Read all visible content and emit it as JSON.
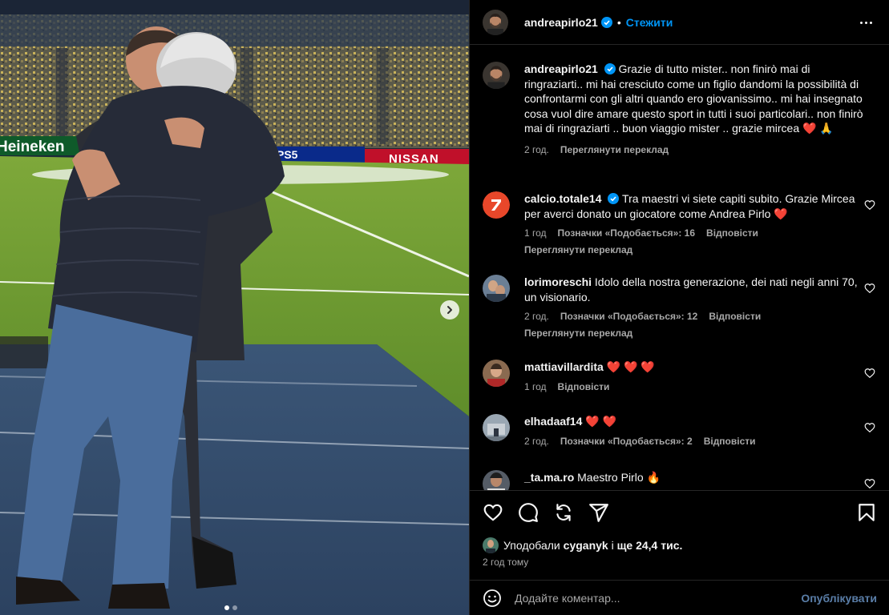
{
  "post": {
    "username": "andreapirlo21",
    "separator": "•",
    "follow_label": "Стежити",
    "caption": "Grazie di tutto mister.. non finirò mai di ringraziarti.. mi hai cresciuto come un figlio dandomi la possibilità di confrontarmi con gli altri quando ero giovanissimo.. mi hai insegnato cosa vuol dire amare questo sport in tutti i suoi particolari.. non finirò mai di ringraziarti .. buon viaggio mister .. grazie mircea ❤️ 🙏",
    "caption_time": "2 год.",
    "caption_translate": "Переглянути переклад"
  },
  "photo": {
    "banners": [
      "Heineken",
      "PS5",
      "NISSAN"
    ]
  },
  "comments": [
    {
      "username": "calcio.totale14",
      "text": "Tra maestri vi siete capiti subito. Grazie Mircea per averci donato un giocatore come Andrea Pirlo ❤️",
      "time": "1 год",
      "likes": "Позначки «Подобається»: 16",
      "reply": "Відповісти",
      "translate": "Переглянути переклад",
      "avatar_color": "#e8472a"
    },
    {
      "username": "lorimoreschi",
      "text": "Idolo della nostra generazione, dei nati negli anni 70, un visionario.",
      "time": "2 год.",
      "likes": "Позначки «Подобається»: 12",
      "reply": "Відповісти",
      "translate": "Переглянути переклад",
      "avatar_color": "#6b7f95"
    },
    {
      "username": "mattiavillardita",
      "text": "❤️ ❤️ ❤️",
      "time": "1 год",
      "likes": "",
      "reply": "Відповісти",
      "avatar_color": "#8a6a50"
    },
    {
      "username": "elhadaaf14",
      "text": "❤️ ❤️",
      "time": "2 год.",
      "likes": "Позначки «Подобається»: 2",
      "reply": "Відповісти",
      "avatar_color": "#9aa7b3"
    },
    {
      "username": "_ta.ma.ro",
      "text": "Maestro Pirlo 🔥",
      "time": "",
      "likes": "",
      "reply": "",
      "avatar_color": "#555c66"
    }
  ],
  "actions": {
    "likes_prefix": "Уподобали",
    "likes_user": "cyganyk",
    "likes_middle": "і",
    "likes_count": "ще 24,4 тис.",
    "posted_ago": "2 год тому"
  },
  "composer": {
    "placeholder": "Додайте коментар...",
    "publish_label": "Опублікувати"
  },
  "colors": {
    "accent": "#0095f6",
    "publish": "#5a7ea8",
    "muted": "#a8a8a8",
    "heart": "#ff3040"
  },
  "icons": [
    "heart-icon",
    "comment-icon",
    "share-icon",
    "send-icon",
    "bookmark-icon",
    "emoji-icon",
    "chevron-right-icon",
    "more-icon",
    "verified-icon"
  ]
}
